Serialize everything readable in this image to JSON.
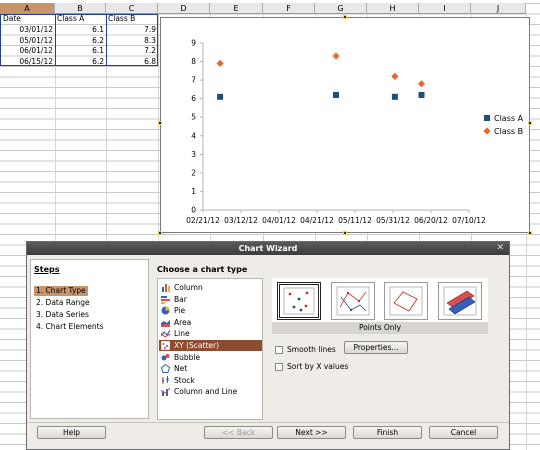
{
  "spreadsheet": {
    "columns": [
      "A",
      "B",
      "C",
      "D",
      "E",
      "F",
      "G",
      "H",
      "I",
      "J"
    ],
    "selected_column": "A",
    "headers": {
      "a1": "Date",
      "b1": "Class A",
      "c1": "Class B"
    },
    "rows": [
      {
        "date": "03/01/12",
        "a": "6.1",
        "b": "7.9"
      },
      {
        "date": "05/01/12",
        "a": "6.2",
        "b": "8.3"
      },
      {
        "date": "06/01/12",
        "a": "6.1",
        "b": "7.2"
      },
      {
        "date": "06/15/12",
        "a": "6.2",
        "b": "6.8"
      }
    ]
  },
  "chart_data": {
    "type": "scatter",
    "title": "",
    "xlabel": "",
    "ylabel": "",
    "x_ticks": [
      "02/21/12",
      "03/12/12",
      "04/01/12",
      "04/21/12",
      "05/11/12",
      "05/31/12",
      "06/20/12",
      "07/10/12"
    ],
    "y_ticks": [
      "0",
      "1",
      "2",
      "3",
      "4",
      "5",
      "6",
      "7",
      "8",
      "9"
    ],
    "ylim": [
      0,
      9
    ],
    "xlim": [
      "02/21/12",
      "07/10/12"
    ],
    "grid": false,
    "legend": "right",
    "series": [
      {
        "name": "Class A",
        "marker": "square",
        "color": "#1f4e79",
        "points": [
          {
            "x": "03/01/12",
            "y": 6.1
          },
          {
            "x": "05/01/12",
            "y": 6.2
          },
          {
            "x": "06/01/12",
            "y": 6.1
          },
          {
            "x": "06/15/12",
            "y": 6.2
          }
        ]
      },
      {
        "name": "Class B",
        "marker": "diamond",
        "color": "#e8682c",
        "points": [
          {
            "x": "03/01/12",
            "y": 7.9
          },
          {
            "x": "05/01/12",
            "y": 8.3
          },
          {
            "x": "06/01/12",
            "y": 7.2
          },
          {
            "x": "06/15/12",
            "y": 6.8
          }
        ]
      }
    ]
  },
  "wizard": {
    "title": "Chart Wizard",
    "close_icon": "close-icon",
    "steps_heading": "Steps",
    "steps": [
      "1. Chart Type",
      "2. Data Range",
      "3. Data Series",
      "4. Chart Elements"
    ],
    "active_step": 0,
    "choose_label": "Choose a chart type",
    "chart_types": [
      {
        "label": "Column",
        "icon": "column-chart-icon"
      },
      {
        "label": "Bar",
        "icon": "bar-chart-icon"
      },
      {
        "label": "Pie",
        "icon": "pie-chart-icon"
      },
      {
        "label": "Area",
        "icon": "area-chart-icon"
      },
      {
        "label": "Line",
        "icon": "line-chart-icon"
      },
      {
        "label": "XY (Scatter)",
        "icon": "scatter-chart-icon"
      },
      {
        "label": "Bubble",
        "icon": "bubble-chart-icon"
      },
      {
        "label": "Net",
        "icon": "net-chart-icon"
      },
      {
        "label": "Stock",
        "icon": "stock-chart-icon"
      },
      {
        "label": "Column and Line",
        "icon": "column-line-chart-icon"
      }
    ],
    "selected_type": 5,
    "variant_label": "Points Only",
    "smooth_lines_label": "Smooth lines",
    "properties_label": "Properties...",
    "sort_x_label": "Sort by X values",
    "buttons": {
      "help": "Help",
      "back": "<< Back",
      "next": "Next >>",
      "finish": "Finish",
      "cancel": "Cancel"
    }
  },
  "colors": {
    "accent": "#c8956a",
    "selection": "#8e4c2e",
    "series_a": "#1f4e79",
    "series_b": "#e8682c"
  }
}
